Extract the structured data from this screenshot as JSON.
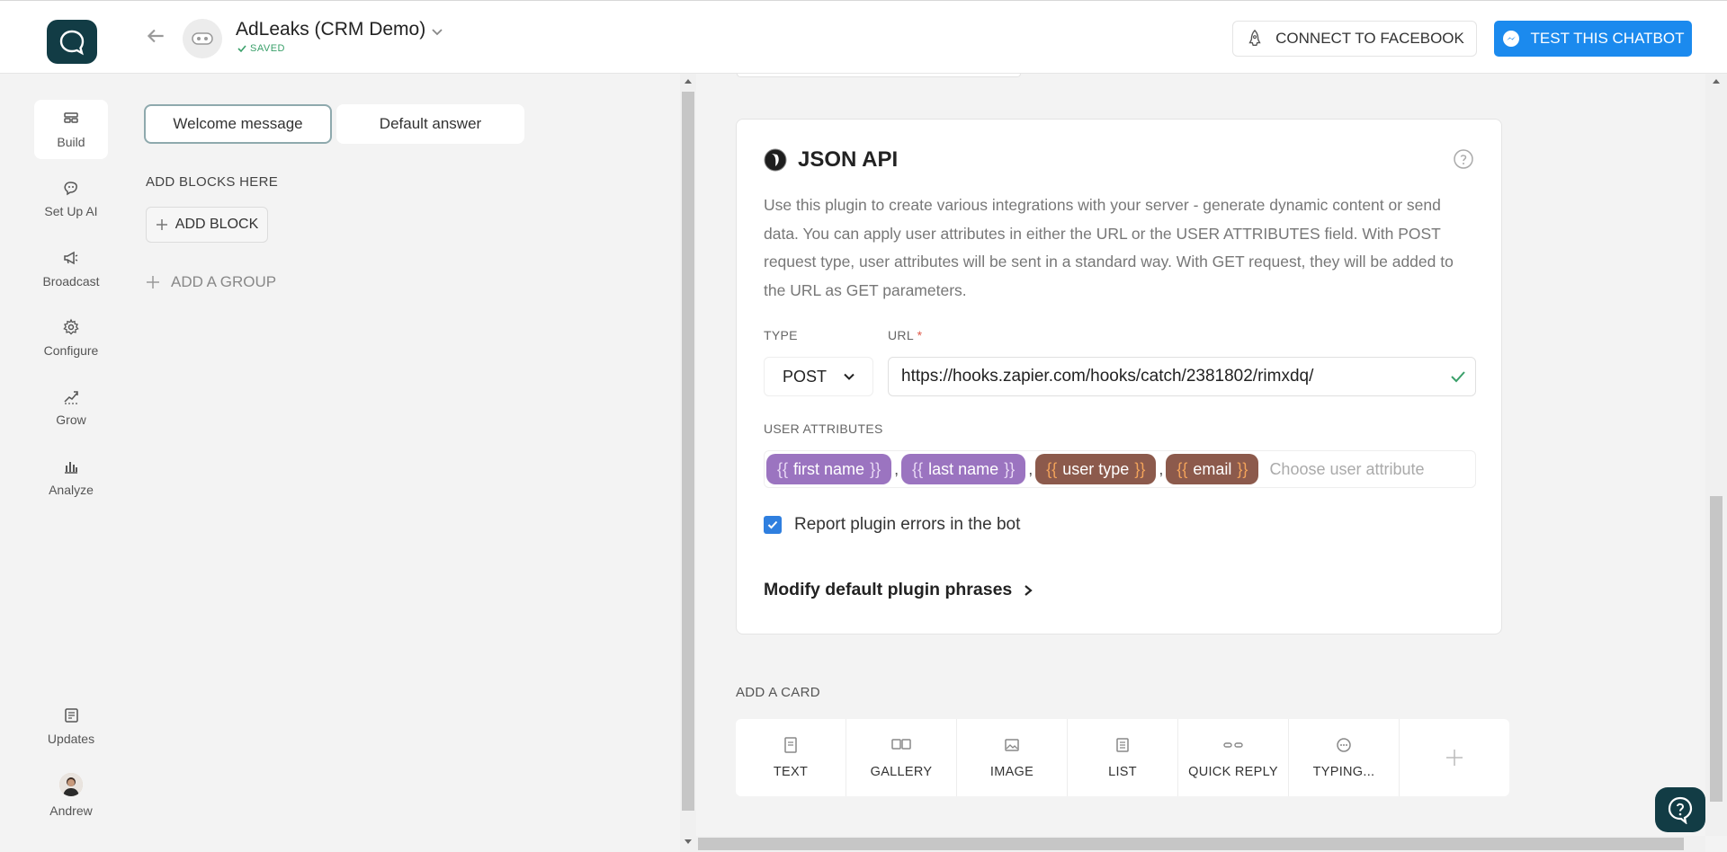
{
  "header": {
    "bot_name": "AdLeaks (CRM Demo)",
    "saved_label": "SAVED",
    "connect_label": "CONNECT TO FACEBOOK",
    "test_label": "TEST THIS CHATBOT",
    "accent": "#1b8aee",
    "logo_color": "#123c45"
  },
  "nav": {
    "items": [
      {
        "label": "Build",
        "icon": "build-icon"
      },
      {
        "label": "Set Up AI",
        "icon": "ai-icon"
      },
      {
        "label": "Broadcast",
        "icon": "megaphone-icon"
      },
      {
        "label": "Configure",
        "icon": "gear-icon"
      },
      {
        "label": "Grow",
        "icon": "trend-icon"
      },
      {
        "label": "Analyze",
        "icon": "bar-chart-icon"
      },
      {
        "label": "Updates",
        "icon": "updates-icon"
      },
      {
        "label": "Andrew",
        "icon": "user-avatar"
      }
    ]
  },
  "blocks": {
    "tabs": [
      "Welcome message",
      "Default answer"
    ],
    "add_blocks_title": "ADD BLOCKS HERE",
    "add_block_label": "ADD BLOCK",
    "add_group_label": "ADD A GROUP"
  },
  "plugin": {
    "title": "JSON API",
    "description": "Use this plugin to create various integrations with your server - generate dynamic content or send data. You can apply user attributes in either the URL or the USER ATTRIBUTES field. With POST request type, user attributes will be sent in a standard way. With GET request, they will be added to the URL as GET parameters.",
    "type_label": "TYPE",
    "type_value": "POST",
    "url_label": "URL",
    "url_required": "*",
    "url_value": "https://hooks.zapier.com/hooks/catch/2381802/rimxdq/",
    "attributes_label": "USER ATTRIBUTES",
    "attributes": [
      {
        "name": "first name",
        "color": "purple"
      },
      {
        "name": "last name",
        "color": "purple"
      },
      {
        "name": "user type",
        "color": "brown"
      },
      {
        "name": "email",
        "color": "brown"
      }
    ],
    "brace_open": "{{",
    "brace_close": "}}",
    "comma": ",",
    "attr_placeholder": "Choose user attribute",
    "report_errors_label": "Report plugin errors in the bot",
    "report_errors_checked": true,
    "modify_label": "Modify default plugin phrases"
  },
  "add_card": {
    "title": "ADD A CARD",
    "types": [
      {
        "label": "TEXT",
        "icon": "text-icon"
      },
      {
        "label": "GALLERY",
        "icon": "gallery-icon"
      },
      {
        "label": "IMAGE",
        "icon": "image-icon"
      },
      {
        "label": "LIST",
        "icon": "list-icon"
      },
      {
        "label": "QUICK REPLY",
        "icon": "quick-reply-icon"
      },
      {
        "label": "TYPING...",
        "icon": "typing-icon"
      },
      {
        "label": "",
        "icon": "plus-icon"
      }
    ]
  }
}
